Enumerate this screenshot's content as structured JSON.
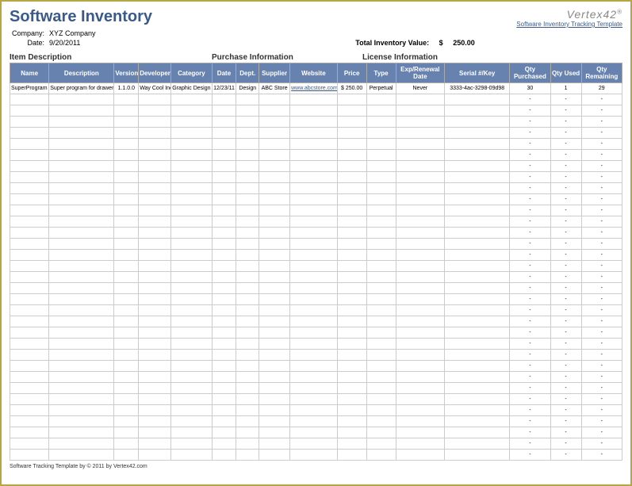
{
  "header": {
    "title": "Software Inventory",
    "logo_text": "Vertex42",
    "logo_link": "Software Inventory Tracking Template"
  },
  "meta": {
    "company_label": "Company:",
    "company_value": "XYZ Company",
    "date_label": "Date:",
    "date_value": "9/20/2011",
    "total_label": "Total Inventory Value:",
    "total_currency": "$",
    "total_value": "250.00"
  },
  "sections": {
    "item": "Item Description",
    "purchase": "Purchase Information",
    "license": "License Information"
  },
  "columns": {
    "name": "Name",
    "description": "Description",
    "version": "Version",
    "developer": "Developer",
    "category": "Category",
    "date": "Date",
    "dept": "Dept.",
    "supplier": "Supplier",
    "website": "Website",
    "price": "Price",
    "type": "Type",
    "renewal": "Exp/Renewal Date",
    "serial": "Serial #/Key",
    "qty_purchased": "Qty Purchased",
    "qty_used": "Qty Used",
    "qty_remaining": "Qty Remaining"
  },
  "rows": [
    {
      "name": "SuperProgram",
      "description": "Super program for drawers",
      "version": "1.1.0.0",
      "developer": "Way Cool Inc",
      "category": "Graphic Design",
      "date": "12/23/11",
      "dept": "Design",
      "supplier": "ABC Store",
      "website": "www.abcstore.com",
      "price": "$ 250.00",
      "type": "Perpetual",
      "renewal": "Never",
      "serial": "3333-4ac-3298-09d98",
      "qty_purchased": "30",
      "qty_used": "1",
      "qty_remaining": "29"
    }
  ],
  "empty_placeholder": "-",
  "footer": "Software Tracking Template by © 2011 by Vertex42.com"
}
